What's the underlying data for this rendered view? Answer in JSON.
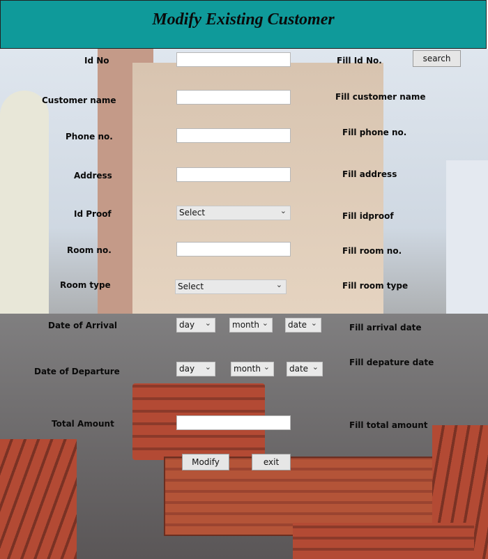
{
  "header": {
    "title": "Modify Existing Customer"
  },
  "fields": {
    "id_no": {
      "label": "Id No",
      "hint": "Fill Id No.",
      "value": ""
    },
    "customer_name": {
      "label": "Customer name",
      "hint": "Fill customer name",
      "value": ""
    },
    "phone": {
      "label": "Phone no.",
      "hint": "Fill phone no.",
      "value": ""
    },
    "address": {
      "label": "Address",
      "hint": "Fill address",
      "value": ""
    },
    "id_proof": {
      "label": "Id Proof",
      "hint": "Fill idproof",
      "selected": "Select"
    },
    "room_no": {
      "label": "Room no.",
      "hint": "Fill room no.",
      "value": ""
    },
    "room_type": {
      "label": "Room type",
      "hint": "Fill room type",
      "selected": "Select"
    },
    "arrival": {
      "label": "Date of Arrival",
      "hint": "Fill arrival date",
      "day": "day",
      "month": "month",
      "date": "date"
    },
    "departure": {
      "label": "Date of Departure",
      "hint": "Fill depature date",
      "day": "day",
      "month": "month",
      "date": "date"
    },
    "total_amount": {
      "label": "Total Amount",
      "hint": "Fill total amount",
      "value": ""
    }
  },
  "buttons": {
    "search": "search",
    "modify": "Modify",
    "exit": "exit"
  },
  "icons": {
    "dropdown": "chevron-down-icon"
  }
}
